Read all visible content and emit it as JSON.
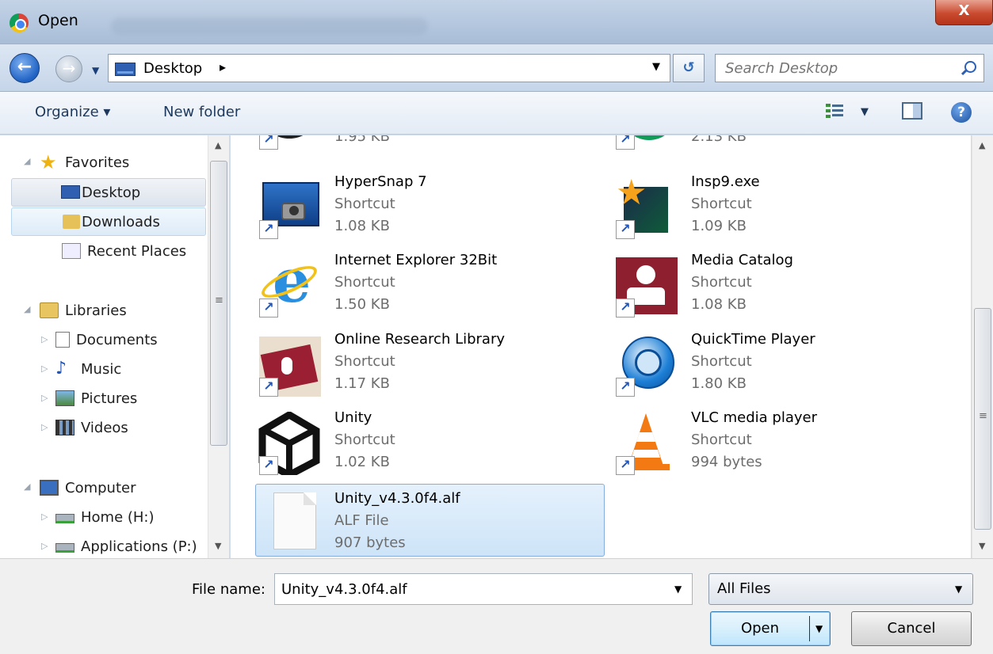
{
  "window": {
    "title": "Open",
    "close_label": "X"
  },
  "address_bar": {
    "location": "Desktop",
    "search_placeholder": "Search Desktop"
  },
  "toolbar": {
    "organize_label": "Organize ▾",
    "new_folder_label": "New folder"
  },
  "nav": {
    "favorites_label": "Favorites",
    "favorites": [
      {
        "label": "Desktop"
      },
      {
        "label": "Downloads"
      },
      {
        "label": "Recent Places"
      }
    ],
    "libraries_label": "Libraries",
    "libraries": [
      {
        "label": "Documents"
      },
      {
        "label": "Music"
      },
      {
        "label": "Pictures"
      },
      {
        "label": "Videos"
      }
    ],
    "computer_label": "Computer",
    "drives": [
      {
        "label": "Home (H:)"
      },
      {
        "label": "Applications (P:)"
      }
    ]
  },
  "files": [
    {
      "name": "",
      "type": "",
      "size": "1.95 KB"
    },
    {
      "name": "",
      "type": "",
      "size": "2.13 KB"
    },
    {
      "name": "HyperSnap 7",
      "type": "Shortcut",
      "size": "1.08 KB"
    },
    {
      "name": "Insp9.exe",
      "type": "Shortcut",
      "size": "1.09 KB"
    },
    {
      "name": "Internet Explorer 32Bit",
      "type": "Shortcut",
      "size": "1.50 KB"
    },
    {
      "name": "Media Catalog",
      "type": "Shortcut",
      "size": "1.08 KB"
    },
    {
      "name": "Online Research Library",
      "type": "Shortcut",
      "size": "1.17 KB"
    },
    {
      "name": "QuickTime Player",
      "type": "Shortcut",
      "size": "1.80 KB"
    },
    {
      "name": "Unity",
      "type": "Shortcut",
      "size": "1.02 KB"
    },
    {
      "name": "VLC media player",
      "type": "Shortcut",
      "size": "994 bytes"
    },
    {
      "name": "Unity_v4.3.0f4.alf",
      "type": "ALF File",
      "size": "907 bytes"
    }
  ],
  "bottom": {
    "file_name_label": "File name:",
    "file_name_value": "Unity_v4.3.0f4.alf",
    "file_type_value": "All Files",
    "open_label": "Open",
    "cancel_label": "Cancel"
  },
  "colors": {
    "selection": "#cde4f8",
    "accent": "#1f62c4",
    "chrome": "#c5d5e9"
  }
}
